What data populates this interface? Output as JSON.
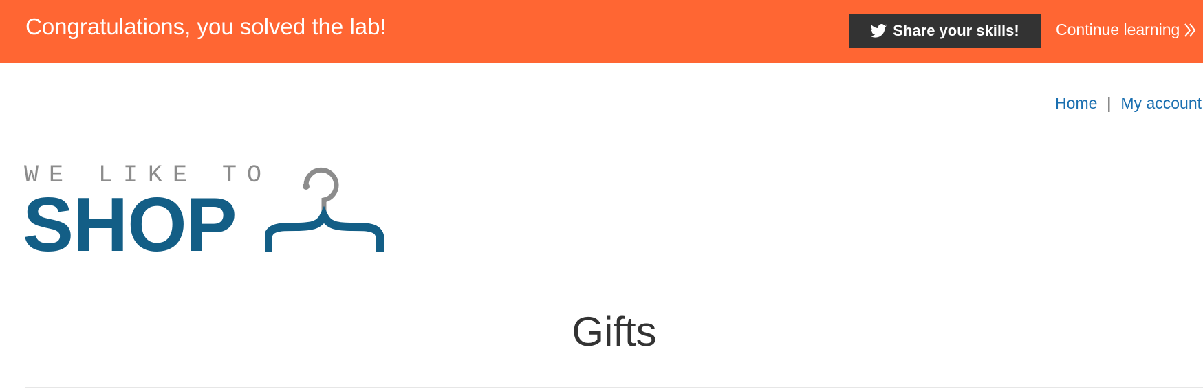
{
  "banner": {
    "title": "Congratulations, you solved the lab!",
    "share_label": "Share your skills!",
    "continue_label": "Continue learning",
    "share_icon": "twitter-icon",
    "continue_icon": "double-chevron-right-icon",
    "background_color": "#ff6633",
    "button_color": "#333333"
  },
  "nav": {
    "home_label": "Home",
    "separator": "|",
    "account_label": "My account",
    "link_color": "#1a6fb0"
  },
  "logo": {
    "line1": "WE LIKE TO",
    "line2": "SHOP",
    "icon": "hanger-icon",
    "brand_color": "#135e86",
    "secondary_color": "#8c8c8c"
  },
  "page": {
    "title": "Gifts"
  }
}
